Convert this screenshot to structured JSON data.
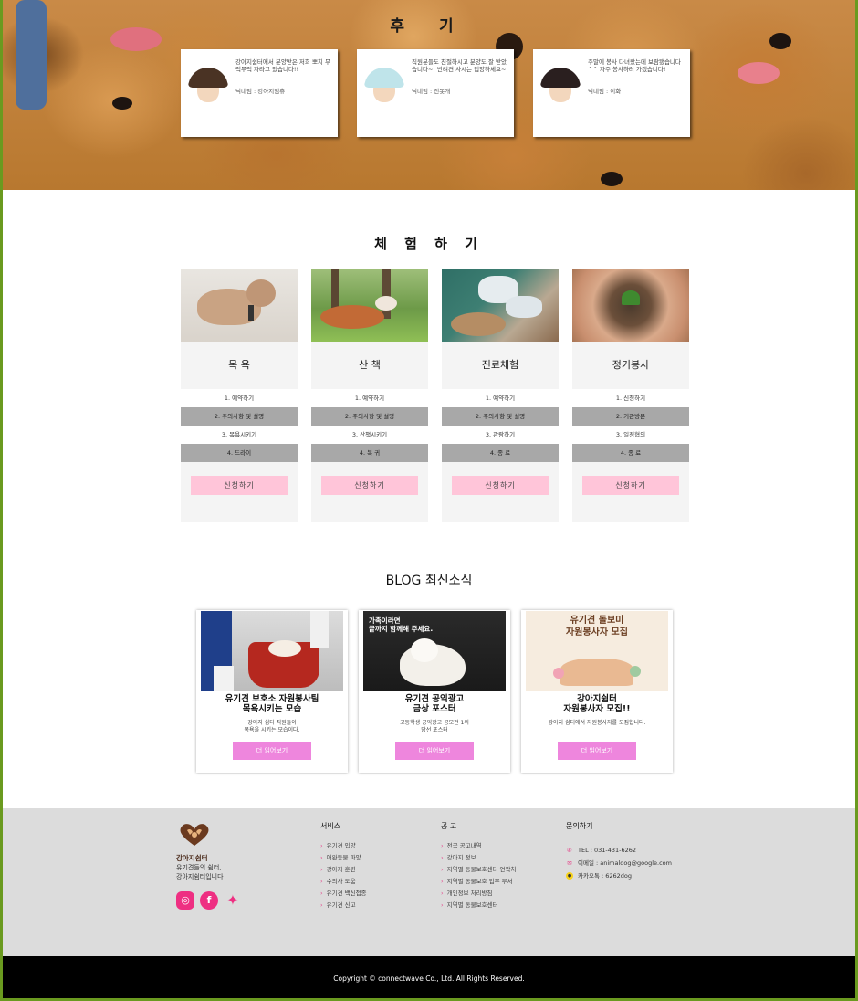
{
  "reviews": {
    "title": "후 기",
    "items": [
      {
        "text": "강아지쉼터에서 분양받은 저희 뽀치 무럭무럭 자라고 있습니다!!",
        "nick": "닉네임 : 강아지엄츄",
        "avatar_hair": "#4a3324"
      },
      {
        "text": "직원분들도 친절하시고 분양도 잘 받았습니다~! 반려견 사시는 입양하세요~",
        "nick": "닉네임 : 진돗개",
        "avatar_hair": "#bfe4ea"
      },
      {
        "text": "주말에 봉사 다녀왔는데 보람됐습니다^^ 자주 봉사하러 가겠습니다!",
        "nick": "닉네임 : 이화",
        "avatar_hair": "#2a1f1f"
      }
    ]
  },
  "experience": {
    "title": "체 험 하 기",
    "cards": [
      {
        "name": "목 욕",
        "steps": [
          "1. 예약하기",
          "2. 주의사항 및 설명",
          "3. 목욕시키기",
          "4. 드라이"
        ],
        "apply": "신청하기"
      },
      {
        "name": "산 책",
        "steps": [
          "1. 예약하기",
          "2. 주의사항 및 설명",
          "3. 산책시키기",
          "4. 복 귀"
        ],
        "apply": "신청하기"
      },
      {
        "name": "진료체험",
        "steps": [
          "1. 예약하기",
          "2. 주의사항 및 설명",
          "3. 관람하기",
          "4. 종 료"
        ],
        "apply": "신청하기"
      },
      {
        "name": "정기봉사",
        "steps": [
          "1. 신청하기",
          "2. 기관방문",
          "3. 일정협의",
          "4. 종 료"
        ],
        "apply": "신청하기"
      }
    ]
  },
  "blog": {
    "title": "BLOG 최신소식",
    "posts": [
      {
        "title": "유기견 보호소 자원봉사팀\n목욕시키는 모습",
        "desc": "강아지 쉼터 직원들이\n목욕을 시키는 모습이다.",
        "more": "더 읽어보기"
      },
      {
        "title": "유기견 공익광고\n금상 포스터",
        "desc": "고등학생 공익광고 공모전 1위\n당선 포스터",
        "more": "더 읽어보기",
        "poster_text": "가족이라면\n끝까지 함께해 주세요."
      },
      {
        "title": "강아지쉼터\n자원봉사자 모집!!",
        "desc": "강아지 쉼터에서 자원봉사자를 모집합니다.",
        "more": "더 읽어보기",
        "poster_text": "유기견 돌보미\n자원봉사자 모집"
      }
    ]
  },
  "footer": {
    "brand": "강아지쉼터",
    "desc": "유기견들의 쉼터,\n강아지쉼터입니다",
    "social": [
      "instagram-icon",
      "facebook-icon",
      "twitter-icon"
    ],
    "services": {
      "head": "서비스",
      "links": [
        "유기견 입양",
        "애완동물 파양",
        "강아지 훈련",
        "수의사 도움",
        "유기견 백신접종",
        "유기견 신고"
      ]
    },
    "notices": {
      "head": "공 고",
      "links": [
        "전국 공고내역",
        "강아지 정보",
        "지역별 동물보호센터 연락처",
        "지역별 동물보호 업무 부서",
        "개인정보 처리방침",
        "지역별 동물보호센터"
      ]
    },
    "contact": {
      "head": "문의하기",
      "tel": "TEL : 031-431-6262",
      "email": "이메일 : animaldog@google.com",
      "kakao": "카카오톡 : 6262dog"
    },
    "copyright": "Copyright © connectwave Co., Ltd. All Rights Reserved."
  }
}
